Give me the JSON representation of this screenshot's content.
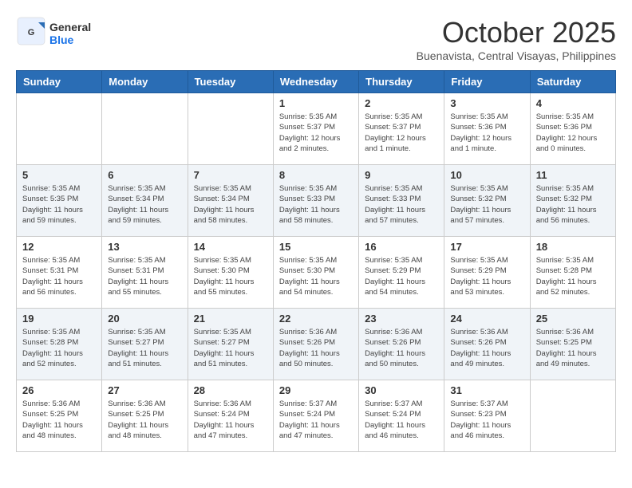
{
  "header": {
    "logo_line1": "General",
    "logo_line2": "Blue",
    "month": "October 2025",
    "location": "Buenavista, Central Visayas, Philippines"
  },
  "days_of_week": [
    "Sunday",
    "Monday",
    "Tuesday",
    "Wednesday",
    "Thursday",
    "Friday",
    "Saturday"
  ],
  "weeks": [
    [
      {
        "day": "",
        "info": ""
      },
      {
        "day": "",
        "info": ""
      },
      {
        "day": "",
        "info": ""
      },
      {
        "day": "1",
        "info": "Sunrise: 5:35 AM\nSunset: 5:37 PM\nDaylight: 12 hours\nand 2 minutes."
      },
      {
        "day": "2",
        "info": "Sunrise: 5:35 AM\nSunset: 5:37 PM\nDaylight: 12 hours\nand 1 minute."
      },
      {
        "day": "3",
        "info": "Sunrise: 5:35 AM\nSunset: 5:36 PM\nDaylight: 12 hours\nand 1 minute."
      },
      {
        "day": "4",
        "info": "Sunrise: 5:35 AM\nSunset: 5:36 PM\nDaylight: 12 hours\nand 0 minutes."
      }
    ],
    [
      {
        "day": "5",
        "info": "Sunrise: 5:35 AM\nSunset: 5:35 PM\nDaylight: 11 hours\nand 59 minutes."
      },
      {
        "day": "6",
        "info": "Sunrise: 5:35 AM\nSunset: 5:34 PM\nDaylight: 11 hours\nand 59 minutes."
      },
      {
        "day": "7",
        "info": "Sunrise: 5:35 AM\nSunset: 5:34 PM\nDaylight: 11 hours\nand 58 minutes."
      },
      {
        "day": "8",
        "info": "Sunrise: 5:35 AM\nSunset: 5:33 PM\nDaylight: 11 hours\nand 58 minutes."
      },
      {
        "day": "9",
        "info": "Sunrise: 5:35 AM\nSunset: 5:33 PM\nDaylight: 11 hours\nand 57 minutes."
      },
      {
        "day": "10",
        "info": "Sunrise: 5:35 AM\nSunset: 5:32 PM\nDaylight: 11 hours\nand 57 minutes."
      },
      {
        "day": "11",
        "info": "Sunrise: 5:35 AM\nSunset: 5:32 PM\nDaylight: 11 hours\nand 56 minutes."
      }
    ],
    [
      {
        "day": "12",
        "info": "Sunrise: 5:35 AM\nSunset: 5:31 PM\nDaylight: 11 hours\nand 56 minutes."
      },
      {
        "day": "13",
        "info": "Sunrise: 5:35 AM\nSunset: 5:31 PM\nDaylight: 11 hours\nand 55 minutes."
      },
      {
        "day": "14",
        "info": "Sunrise: 5:35 AM\nSunset: 5:30 PM\nDaylight: 11 hours\nand 55 minutes."
      },
      {
        "day": "15",
        "info": "Sunrise: 5:35 AM\nSunset: 5:30 PM\nDaylight: 11 hours\nand 54 minutes."
      },
      {
        "day": "16",
        "info": "Sunrise: 5:35 AM\nSunset: 5:29 PM\nDaylight: 11 hours\nand 54 minutes."
      },
      {
        "day": "17",
        "info": "Sunrise: 5:35 AM\nSunset: 5:29 PM\nDaylight: 11 hours\nand 53 minutes."
      },
      {
        "day": "18",
        "info": "Sunrise: 5:35 AM\nSunset: 5:28 PM\nDaylight: 11 hours\nand 52 minutes."
      }
    ],
    [
      {
        "day": "19",
        "info": "Sunrise: 5:35 AM\nSunset: 5:28 PM\nDaylight: 11 hours\nand 52 minutes."
      },
      {
        "day": "20",
        "info": "Sunrise: 5:35 AM\nSunset: 5:27 PM\nDaylight: 11 hours\nand 51 minutes."
      },
      {
        "day": "21",
        "info": "Sunrise: 5:35 AM\nSunset: 5:27 PM\nDaylight: 11 hours\nand 51 minutes."
      },
      {
        "day": "22",
        "info": "Sunrise: 5:36 AM\nSunset: 5:26 PM\nDaylight: 11 hours\nand 50 minutes."
      },
      {
        "day": "23",
        "info": "Sunrise: 5:36 AM\nSunset: 5:26 PM\nDaylight: 11 hours\nand 50 minutes."
      },
      {
        "day": "24",
        "info": "Sunrise: 5:36 AM\nSunset: 5:26 PM\nDaylight: 11 hours\nand 49 minutes."
      },
      {
        "day": "25",
        "info": "Sunrise: 5:36 AM\nSunset: 5:25 PM\nDaylight: 11 hours\nand 49 minutes."
      }
    ],
    [
      {
        "day": "26",
        "info": "Sunrise: 5:36 AM\nSunset: 5:25 PM\nDaylight: 11 hours\nand 48 minutes."
      },
      {
        "day": "27",
        "info": "Sunrise: 5:36 AM\nSunset: 5:25 PM\nDaylight: 11 hours\nand 48 minutes."
      },
      {
        "day": "28",
        "info": "Sunrise: 5:36 AM\nSunset: 5:24 PM\nDaylight: 11 hours\nand 47 minutes."
      },
      {
        "day": "29",
        "info": "Sunrise: 5:37 AM\nSunset: 5:24 PM\nDaylight: 11 hours\nand 47 minutes."
      },
      {
        "day": "30",
        "info": "Sunrise: 5:37 AM\nSunset: 5:24 PM\nDaylight: 11 hours\nand 46 minutes."
      },
      {
        "day": "31",
        "info": "Sunrise: 5:37 AM\nSunset: 5:23 PM\nDaylight: 11 hours\nand 46 minutes."
      },
      {
        "day": "",
        "info": ""
      }
    ]
  ]
}
